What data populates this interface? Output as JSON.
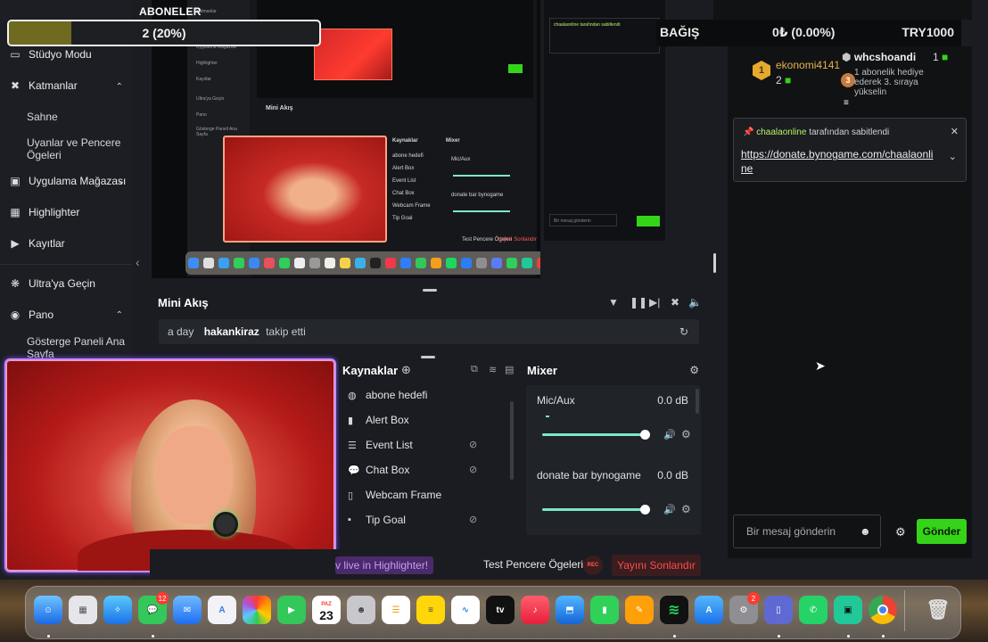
{
  "header": {
    "subscribers_title": "ABONELER",
    "subscriber_progress": "2 (20%)",
    "subscriber_fraction": 0.2
  },
  "sidebar": {
    "items": [
      {
        "label": "Stüdyo Modu",
        "icon": "layout-icon"
      },
      {
        "label": "Katmanlar",
        "icon": "layers-icon"
      },
      {
        "label": "Sahne"
      },
      {
        "label": "Uyanlar ve Pencere Ögeleri"
      },
      {
        "label": "Uygulama Mağazası",
        "icon": "store-icon"
      },
      {
        "label": "Highlighter",
        "icon": "highlighter-icon"
      },
      {
        "label": "Kayıtlar",
        "icon": "play-icon"
      },
      {
        "label": "Ultra'ya Geçin",
        "icon": "ultra-icon"
      },
      {
        "label": "Pano",
        "icon": "dashboard-icon"
      },
      {
        "label": "Gösterge Paneli Ana Sayfa"
      }
    ]
  },
  "donation": {
    "label": "BAĞIŞ",
    "progress": "0₺ (0.00%)",
    "goal": "TRY1000"
  },
  "leaderboard": {
    "rank_badge": "1",
    "first_user": "ekonomi4141",
    "first_count": "2",
    "second_user": "whcshoandi",
    "second_count": "1",
    "second_note": "1 abonelik hediye ederek 3. sıraya yükselin",
    "third_badge": "3"
  },
  "pinned": {
    "user": "chaalaonline",
    "suffix": "tarafından sabitlendi",
    "link": "https://donate.bynogame.com/chaalaonline"
  },
  "chat": {
    "input_placeholder": "Bir mesaj gönderin",
    "send": "Gönder"
  },
  "mini_feed": {
    "title": "Mini Akış",
    "time": "a day",
    "user": "hakankiraz",
    "action": "takip etti"
  },
  "sources": {
    "title": "Kaynaklar",
    "items": [
      "abone hedefi",
      "Alert Box",
      "Event List",
      "Chat Box",
      "Webcam Frame",
      "Tip Goal"
    ]
  },
  "mixer": {
    "title": "Mixer",
    "channels": [
      {
        "name": "Mic/Aux",
        "db": "0.0 dB"
      },
      {
        "name": "donate bar bynogame",
        "db": "0.0 dB"
      }
    ]
  },
  "bottombar": {
    "highlighter": "v live in Highlighter!",
    "test": "Test Pencere Ögeleri",
    "rec": "REC",
    "end": "Yayını Sonlandır"
  },
  "dock": {
    "calendar_month": "PAZ",
    "calendar_day": "23",
    "badge_messages": "12",
    "badge_settings": "2"
  },
  "colors": {
    "accent_green": "#35d419",
    "danger": "#ff4b4b",
    "mixer_slider": "#7de6cc"
  }
}
